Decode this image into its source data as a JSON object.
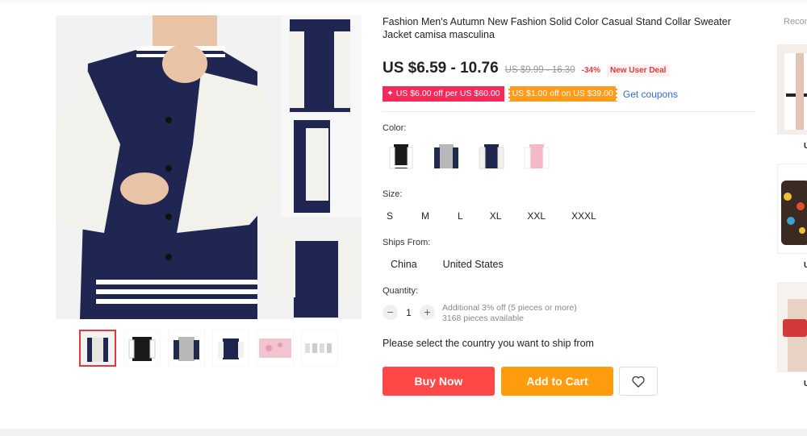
{
  "product": {
    "title": "Fashion Men's Autumn New Fashion Solid Color Casual Stand Collar Sweater Jacket camisa masculina",
    "price": "US $6.59 - 10.76",
    "original_price": "US $9.99 - 16.30",
    "discount": "-34%",
    "new_user_deal": "New User Deal"
  },
  "coupons": {
    "coupon_1": "✦ US $6.00 off per US $60.00",
    "coupon_2": "US $1.00 off on US $39.00",
    "get_coupons": "Get coupons"
  },
  "color": {
    "label": "Color:",
    "swatches": [
      {
        "name": "black-white",
        "body": "#1a1a1a",
        "sleeve": "#ffffff"
      },
      {
        "name": "grey-navy",
        "body": "#b8b8b8",
        "sleeve": "#1f2a4d"
      },
      {
        "name": "navy-white",
        "body": "#1e2650",
        "sleeve": "#ffffff"
      },
      {
        "name": "pink-white",
        "body": "#f5b8c6",
        "sleeve": "#ffffff"
      }
    ]
  },
  "size": {
    "label": "Size:",
    "options": [
      "S",
      "M",
      "L",
      "XL",
      "XXL",
      "XXXL"
    ]
  },
  "ships_from": {
    "label": "Ships From:",
    "options": [
      "China",
      "United States"
    ]
  },
  "quantity": {
    "label": "Quantity:",
    "minus": "−",
    "value": "1",
    "plus": "+",
    "note_1": "Additional 3% off (5 pieces or more)",
    "note_2": "3168 pieces available"
  },
  "ship_message": "Please select the country you want to ship from",
  "actions": {
    "buy_now": "Buy Now",
    "add_to_cart": "Add to Cart"
  },
  "recommended": {
    "title": "Recom",
    "items": [
      {
        "price": "U"
      },
      {
        "price": "U"
      },
      {
        "price": "U"
      }
    ]
  },
  "colors": {
    "accent_red": "#ff4747",
    "accent_orange": "#ff9c0d",
    "link_blue": "#2e6ad6",
    "navy": "#1e2650"
  }
}
